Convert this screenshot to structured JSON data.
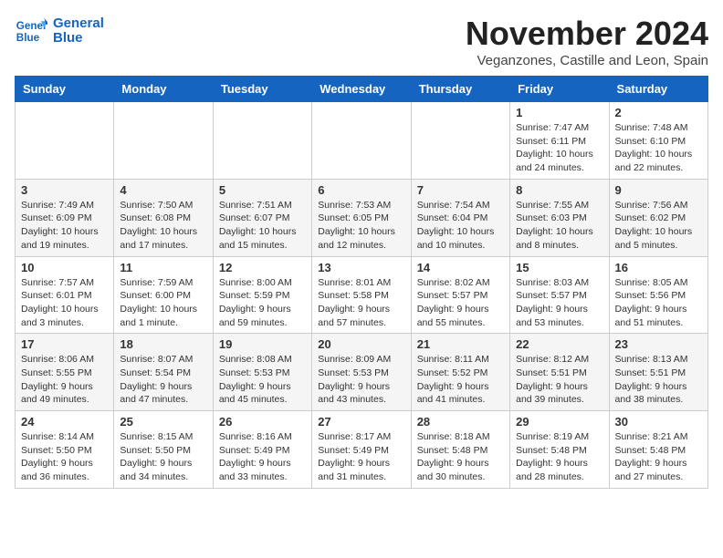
{
  "logo": {
    "line1": "General",
    "line2": "Blue"
  },
  "title": "November 2024",
  "location": "Veganzones, Castille and Leon, Spain",
  "weekdays": [
    "Sunday",
    "Monday",
    "Tuesday",
    "Wednesday",
    "Thursday",
    "Friday",
    "Saturday"
  ],
  "weeks": [
    [
      null,
      null,
      null,
      null,
      null,
      {
        "day": "1",
        "sunrise": "Sunrise: 7:47 AM",
        "sunset": "Sunset: 6:11 PM",
        "daylight": "Daylight: 10 hours and 24 minutes."
      },
      {
        "day": "2",
        "sunrise": "Sunrise: 7:48 AM",
        "sunset": "Sunset: 6:10 PM",
        "daylight": "Daylight: 10 hours and 22 minutes."
      }
    ],
    [
      {
        "day": "3",
        "sunrise": "Sunrise: 7:49 AM",
        "sunset": "Sunset: 6:09 PM",
        "daylight": "Daylight: 10 hours and 19 minutes."
      },
      {
        "day": "4",
        "sunrise": "Sunrise: 7:50 AM",
        "sunset": "Sunset: 6:08 PM",
        "daylight": "Daylight: 10 hours and 17 minutes."
      },
      {
        "day": "5",
        "sunrise": "Sunrise: 7:51 AM",
        "sunset": "Sunset: 6:07 PM",
        "daylight": "Daylight: 10 hours and 15 minutes."
      },
      {
        "day": "6",
        "sunrise": "Sunrise: 7:53 AM",
        "sunset": "Sunset: 6:05 PM",
        "daylight": "Daylight: 10 hours and 12 minutes."
      },
      {
        "day": "7",
        "sunrise": "Sunrise: 7:54 AM",
        "sunset": "Sunset: 6:04 PM",
        "daylight": "Daylight: 10 hours and 10 minutes."
      },
      {
        "day": "8",
        "sunrise": "Sunrise: 7:55 AM",
        "sunset": "Sunset: 6:03 PM",
        "daylight": "Daylight: 10 hours and 8 minutes."
      },
      {
        "day": "9",
        "sunrise": "Sunrise: 7:56 AM",
        "sunset": "Sunset: 6:02 PM",
        "daylight": "Daylight: 10 hours and 5 minutes."
      }
    ],
    [
      {
        "day": "10",
        "sunrise": "Sunrise: 7:57 AM",
        "sunset": "Sunset: 6:01 PM",
        "daylight": "Daylight: 10 hours and 3 minutes."
      },
      {
        "day": "11",
        "sunrise": "Sunrise: 7:59 AM",
        "sunset": "Sunset: 6:00 PM",
        "daylight": "Daylight: 10 hours and 1 minute."
      },
      {
        "day": "12",
        "sunrise": "Sunrise: 8:00 AM",
        "sunset": "Sunset: 5:59 PM",
        "daylight": "Daylight: 9 hours and 59 minutes."
      },
      {
        "day": "13",
        "sunrise": "Sunrise: 8:01 AM",
        "sunset": "Sunset: 5:58 PM",
        "daylight": "Daylight: 9 hours and 57 minutes."
      },
      {
        "day": "14",
        "sunrise": "Sunrise: 8:02 AM",
        "sunset": "Sunset: 5:57 PM",
        "daylight": "Daylight: 9 hours and 55 minutes."
      },
      {
        "day": "15",
        "sunrise": "Sunrise: 8:03 AM",
        "sunset": "Sunset: 5:57 PM",
        "daylight": "Daylight: 9 hours and 53 minutes."
      },
      {
        "day": "16",
        "sunrise": "Sunrise: 8:05 AM",
        "sunset": "Sunset: 5:56 PM",
        "daylight": "Daylight: 9 hours and 51 minutes."
      }
    ],
    [
      {
        "day": "17",
        "sunrise": "Sunrise: 8:06 AM",
        "sunset": "Sunset: 5:55 PM",
        "daylight": "Daylight: 9 hours and 49 minutes."
      },
      {
        "day": "18",
        "sunrise": "Sunrise: 8:07 AM",
        "sunset": "Sunset: 5:54 PM",
        "daylight": "Daylight: 9 hours and 47 minutes."
      },
      {
        "day": "19",
        "sunrise": "Sunrise: 8:08 AM",
        "sunset": "Sunset: 5:53 PM",
        "daylight": "Daylight: 9 hours and 45 minutes."
      },
      {
        "day": "20",
        "sunrise": "Sunrise: 8:09 AM",
        "sunset": "Sunset: 5:53 PM",
        "daylight": "Daylight: 9 hours and 43 minutes."
      },
      {
        "day": "21",
        "sunrise": "Sunrise: 8:11 AM",
        "sunset": "Sunset: 5:52 PM",
        "daylight": "Daylight: 9 hours and 41 minutes."
      },
      {
        "day": "22",
        "sunrise": "Sunrise: 8:12 AM",
        "sunset": "Sunset: 5:51 PM",
        "daylight": "Daylight: 9 hours and 39 minutes."
      },
      {
        "day": "23",
        "sunrise": "Sunrise: 8:13 AM",
        "sunset": "Sunset: 5:51 PM",
        "daylight": "Daylight: 9 hours and 38 minutes."
      }
    ],
    [
      {
        "day": "24",
        "sunrise": "Sunrise: 8:14 AM",
        "sunset": "Sunset: 5:50 PM",
        "daylight": "Daylight: 9 hours and 36 minutes."
      },
      {
        "day": "25",
        "sunrise": "Sunrise: 8:15 AM",
        "sunset": "Sunset: 5:50 PM",
        "daylight": "Daylight: 9 hours and 34 minutes."
      },
      {
        "day": "26",
        "sunrise": "Sunrise: 8:16 AM",
        "sunset": "Sunset: 5:49 PM",
        "daylight": "Daylight: 9 hours and 33 minutes."
      },
      {
        "day": "27",
        "sunrise": "Sunrise: 8:17 AM",
        "sunset": "Sunset: 5:49 PM",
        "daylight": "Daylight: 9 hours and 31 minutes."
      },
      {
        "day": "28",
        "sunrise": "Sunrise: 8:18 AM",
        "sunset": "Sunset: 5:48 PM",
        "daylight": "Daylight: 9 hours and 30 minutes."
      },
      {
        "day": "29",
        "sunrise": "Sunrise: 8:19 AM",
        "sunset": "Sunset: 5:48 PM",
        "daylight": "Daylight: 9 hours and 28 minutes."
      },
      {
        "day": "30",
        "sunrise": "Sunrise: 8:21 AM",
        "sunset": "Sunset: 5:48 PM",
        "daylight": "Daylight: 9 hours and 27 minutes."
      }
    ]
  ]
}
